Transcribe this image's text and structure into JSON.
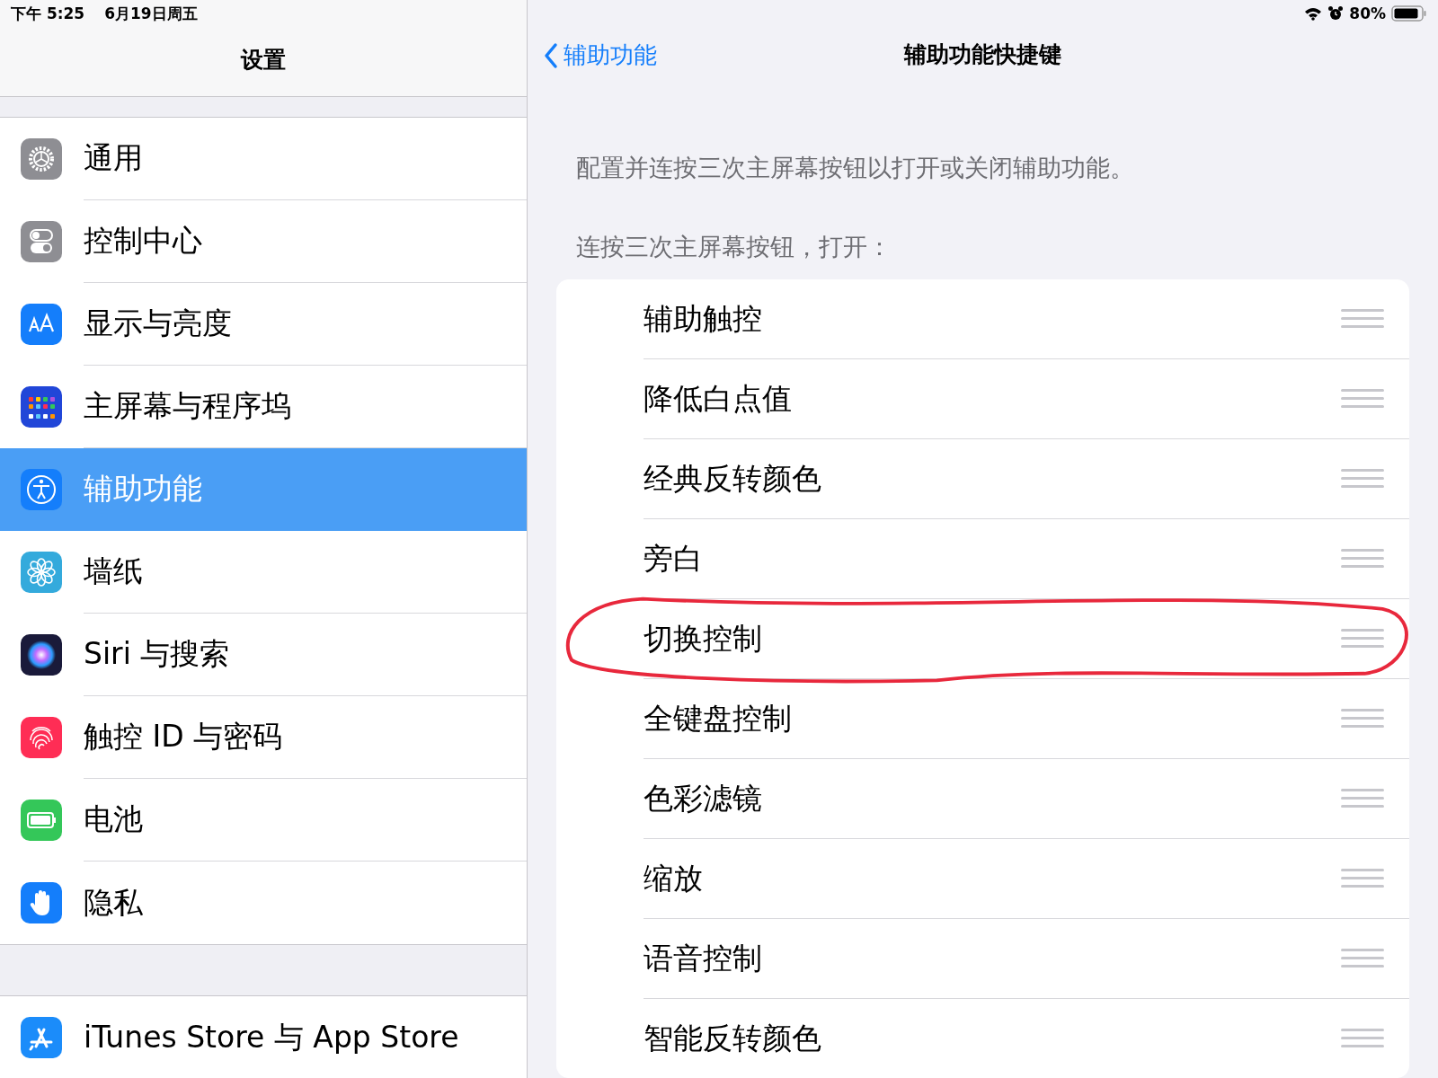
{
  "status_bar": {
    "time": "下午 5:25",
    "date": "6月19日周五",
    "battery": "80%"
  },
  "sidebar": {
    "title": "设置",
    "groups": [
      {
        "items": [
          {
            "label": "通用",
            "selected": false
          },
          {
            "label": "控制中心",
            "selected": false
          },
          {
            "label": "显示与亮度",
            "selected": false
          },
          {
            "label": "主屏幕与程序坞",
            "selected": false
          },
          {
            "label": "辅助功能",
            "selected": true
          },
          {
            "label": "墙纸",
            "selected": false
          },
          {
            "label": "Siri 与搜索",
            "selected": false
          },
          {
            "label": "触控 ID 与密码",
            "selected": false
          },
          {
            "label": "电池",
            "selected": false
          },
          {
            "label": "隐私",
            "selected": false
          }
        ]
      },
      {
        "items": [
          {
            "label": "iTunes Store 与 App Store",
            "selected": false
          }
        ]
      }
    ]
  },
  "detail": {
    "back": "辅助功能",
    "title": "辅助功能快捷键",
    "description": "配置并连按三次主屏幕按钮以打开或关闭辅助功能。",
    "section_header": "连按三次主屏幕按钮，打开：",
    "options": [
      {
        "label": "辅助触控",
        "circled": false
      },
      {
        "label": "降低白点值",
        "circled": false
      },
      {
        "label": "经典反转颜色",
        "circled": false
      },
      {
        "label": "旁白",
        "circled": false
      },
      {
        "label": "切换控制",
        "circled": true
      },
      {
        "label": "全键盘控制",
        "circled": false
      },
      {
        "label": "色彩滤镜",
        "circled": false
      },
      {
        "label": "缩放",
        "circled": false
      },
      {
        "label": "语音控制",
        "circled": false
      },
      {
        "label": "智能反转颜色",
        "circled": false
      }
    ]
  }
}
